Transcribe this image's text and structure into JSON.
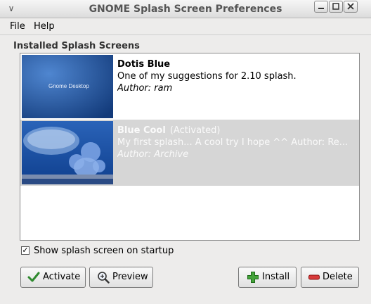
{
  "window": {
    "title": "GNOME Splash Screen Preferences"
  },
  "menu": {
    "file": "File",
    "help": "Help"
  },
  "section_label": "Installed Splash Screens",
  "splashes": [
    {
      "name": "Dotis Blue",
      "activated": "",
      "description": "One of my suggestions for 2.10 splash.",
      "author": "Author: ram",
      "thumb_text": "Gnome Desktop",
      "selected": false
    },
    {
      "name": "Blue Cool",
      "activated": "(Activated)",
      "description": "My first splash... A cool try I hope ^^  Author: Re...",
      "author": "Author: Archive",
      "thumb_text": "",
      "selected": true
    }
  ],
  "show_on_startup": {
    "label": "Show splash screen on startup",
    "checked": true
  },
  "buttons": {
    "activate": "Activate",
    "preview": "Preview",
    "install": "Install",
    "delete": "Delete"
  },
  "icons": {
    "activate": "checkmark-icon",
    "preview": "magnifier-icon",
    "install": "plus-icon",
    "delete": "minus-icon"
  },
  "colors": {
    "selection": "#d6d6d6",
    "thumb_blue": "#2f5fa8"
  }
}
